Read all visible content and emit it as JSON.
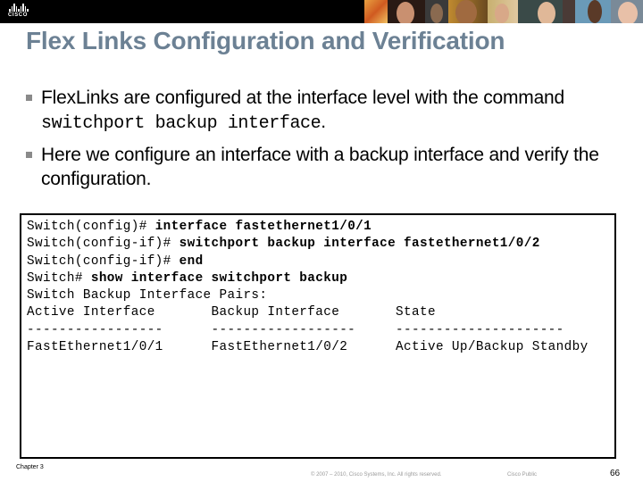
{
  "header": {
    "logo_text": "CISCO",
    "photo_strip": "header-photo-strip"
  },
  "slide": {
    "title": "Flex Links Configuration and Verification",
    "bullets": [
      {
        "text_before": "FlexLinks are configured at the interface level with the command ",
        "code": "switchport backup interface",
        "text_after": "."
      },
      {
        "text": "Here we configure an interface with a backup interface and verify the configuration."
      }
    ],
    "code_block": [
      {
        "prompt": "Switch(config)# ",
        "command": "interface fastethernet1/0/1"
      },
      {
        "prompt": "Switch(config-if)# ",
        "command": "switchport backup interface fastethernet1/0/2"
      },
      {
        "prompt": "Switch(config-if)# ",
        "command": "end"
      },
      {
        "prompt": "Switch# ",
        "command": "show interface switchport backup"
      },
      {
        "prompt": "Switch Backup Interface Pairs:",
        "command": ""
      },
      {
        "prompt": "Active Interface       Backup Interface       State",
        "command": ""
      },
      {
        "prompt": "-----------------      ------------------     ---------------------",
        "command": ""
      },
      {
        "prompt": "FastEthernet1/0/1      FastEthernet1/0/2      Active Up/Backup Standby",
        "command": ""
      }
    ]
  },
  "footer": {
    "chapter": "Chapter 3",
    "copyright": "© 2007 – 2010, Cisco Systems, Inc. All rights reserved.",
    "classification": "Cisco Public",
    "page_number": "66"
  },
  "colors": {
    "title": "#6c8194",
    "header_bar": "#000000",
    "bullet_marker": "#8a8a8a"
  }
}
